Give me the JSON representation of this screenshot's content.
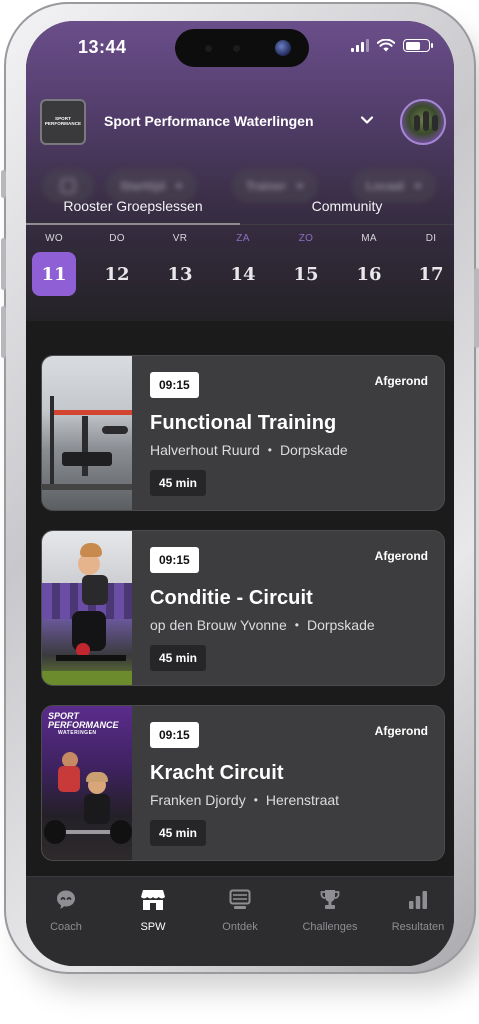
{
  "status_bar": {
    "time": "13:44"
  },
  "header": {
    "club_name": "Sport Performance Waterlingen",
    "club_logo_text": "SPORT PERFORMANCE"
  },
  "filters": {
    "chips": [
      {
        "label": "Starttijd"
      },
      {
        "label": "Trainer"
      },
      {
        "label": "Locaal"
      }
    ]
  },
  "tabs": [
    {
      "label": "Rooster Groepslessen",
      "active": true
    },
    {
      "label": "Community",
      "active": false
    }
  ],
  "week": [
    {
      "day": "WO",
      "num": "11",
      "selected": true,
      "weekend": false
    },
    {
      "day": "DO",
      "num": "12",
      "selected": false,
      "weekend": false
    },
    {
      "day": "VR",
      "num": "13",
      "selected": false,
      "weekend": false
    },
    {
      "day": "ZA",
      "num": "14",
      "selected": false,
      "weekend": true
    },
    {
      "day": "ZO",
      "num": "15",
      "selected": false,
      "weekend": true
    },
    {
      "day": "MA",
      "num": "16",
      "selected": false,
      "weekend": false
    },
    {
      "day": "DI",
      "num": "17",
      "selected": false,
      "weekend": false
    }
  ],
  "classes": [
    {
      "time": "09:15",
      "status": "Afgerond",
      "title": "Functional Training",
      "trainer": "Halverhout Ruurd",
      "location": "Dorpskade",
      "duration": "45 min",
      "image": "gym-equipment-photo"
    },
    {
      "time": "09:15",
      "status": "Afgerond",
      "title": "Conditie - Circuit",
      "trainer": "op den Brouw Yvonne",
      "location": "Dorpskade",
      "duration": "45 min",
      "image": "spin-bike-photo"
    },
    {
      "time": "09:15",
      "status": "Afgerond",
      "title": "Kracht Circuit",
      "trainer": "Franken Djordy",
      "location": "Herenstraat",
      "duration": "45 min",
      "image": "barbell-lifting-photo",
      "image_brand": "SPORT PERFORMANCE",
      "image_brand_sub": "WATERINGEN"
    }
  ],
  "bottom_nav": [
    {
      "label": "Coach",
      "icon": "coach-icon",
      "active": false
    },
    {
      "label": "SPW",
      "icon": "store-icon",
      "active": true
    },
    {
      "label": "Ontdek",
      "icon": "monitor-icon",
      "active": false
    },
    {
      "label": "Challenges",
      "icon": "trophy-icon",
      "active": false
    },
    {
      "label": "Resultaten",
      "icon": "bar-chart-icon",
      "active": false
    }
  ],
  "colors": {
    "accent": "#8f5fd6",
    "header_top": "#6a4e8a",
    "card_bg": "#3d3d3f",
    "nav_bg": "#2d2c2e",
    "weekend_text": "#8b6fc2"
  }
}
